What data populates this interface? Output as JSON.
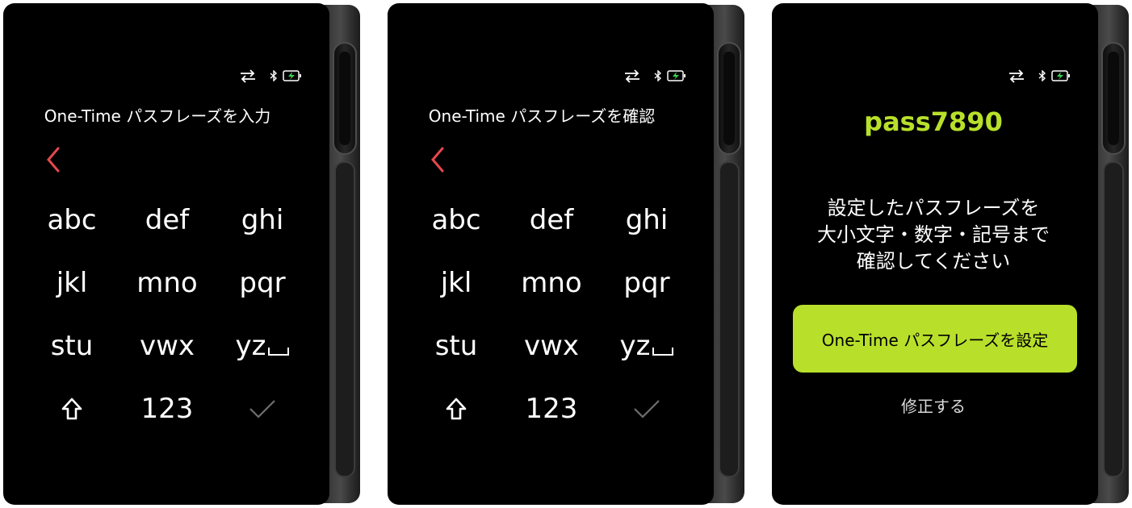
{
  "colors": {
    "accent": "#b8e02b",
    "back_arrow": "#e5484d",
    "check_disabled": "#6e6e6e",
    "screen_bg": "#000000",
    "battery": "#39d353"
  },
  "status_icons": [
    "sync-arrows-icon",
    "bluetooth-icon",
    "battery-charging-icon"
  ],
  "screens": [
    {
      "title": "One-Time パスフレーズを入力",
      "keys": [
        "abc",
        "def",
        "ghi",
        "jkl",
        "mno",
        "pqr",
        "stu",
        "vwx",
        "yz",
        "",
        "123",
        ""
      ]
    },
    {
      "title": "One-Time パスフレーズを確認",
      "keys": [
        "abc",
        "def",
        "ghi",
        "jkl",
        "mno",
        "pqr",
        "stu",
        "vwx",
        "yz",
        "",
        "123",
        ""
      ]
    },
    {
      "passphrase": "pass7890",
      "message": [
        "設定したパスフレーズを",
        "大小文字・数字・記号まで",
        "確認してください"
      ],
      "primary_button": "One-Time パスフレーズを設定",
      "secondary_link": "修正する"
    }
  ]
}
